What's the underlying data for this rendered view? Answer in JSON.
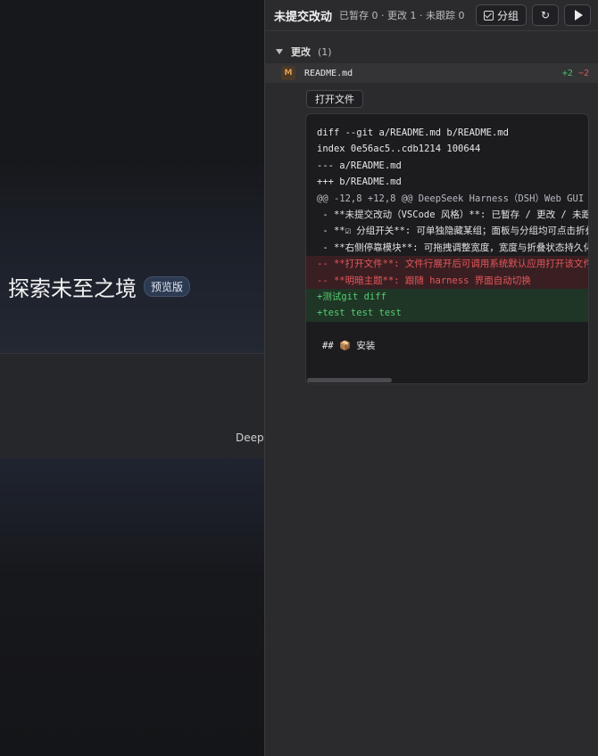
{
  "left": {
    "title": "探索未至之境",
    "badge": "预览版",
    "cut_text": "DeepS"
  },
  "panel": {
    "title": "未提交改动",
    "summary": "已暂存 0 · 更改 1 · 未跟踪 0",
    "group_label": "分组",
    "refresh_icon": "↻",
    "run_icon": "play-icon"
  },
  "section": {
    "title": "更改",
    "count": "(1)"
  },
  "file": {
    "status": "M",
    "name": "README.md",
    "additions": "+2",
    "deletions": "−2"
  },
  "open_file_label": "打开文件",
  "diff": {
    "lines": [
      {
        "type": "meta",
        "text": "diff --git a/README.md b/README.md"
      },
      {
        "type": "meta",
        "text": "index 0e56ac5..cdb1214 100644"
      },
      {
        "type": "meta",
        "text": "--- a/README.md"
      },
      {
        "type": "meta",
        "text": "+++ b/README.md"
      },
      {
        "type": "hunk",
        "text": "@@ -12,8 +12,8 @@ DeepSeek Harness（DSH）Web GUI"
      },
      {
        "type": "ctx",
        "text": " - **未提交改动（VSCode 风格）**: 已暂存 / 更改 / 未跟踪"
      },
      {
        "type": "ctx",
        "text": " - **☑ 分组开关**: 可单独隐藏某组；面板与分组均可点击折叠"
      },
      {
        "type": "ctx",
        "text": " - **右侧停靠模块**: 可拖拽调整宽度，宽度与折叠状态持久化"
      },
      {
        "type": "del",
        "text": "-- **打开文件**: 文件行展开后可调用系统默认应用打开该文件"
      },
      {
        "type": "del",
        "text": "-- **明暗主题**: 跟随 harness 界面自动切换"
      },
      {
        "type": "add",
        "text": "+测试git diff"
      },
      {
        "type": "add",
        "text": "+test test test"
      },
      {
        "type": "blank",
        "text": ""
      },
      {
        "type": "last",
        "text": "## 📦 安装"
      }
    ]
  },
  "colors": {
    "added": "#55cc70",
    "deleted": "#e5575b",
    "modified_badge": "#e0a050"
  }
}
